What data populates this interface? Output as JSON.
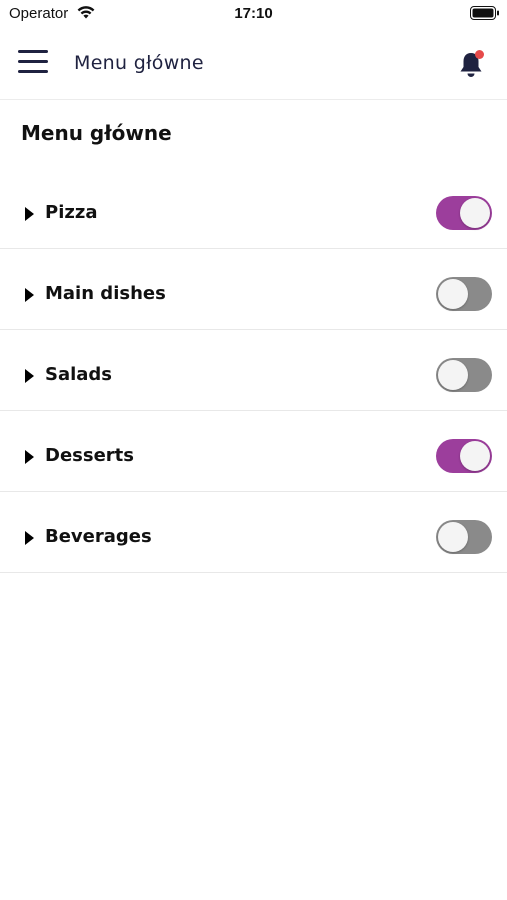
{
  "status_bar": {
    "carrier": "Operator",
    "time": "17:10",
    "wifi_icon": "wifi-icon",
    "battery_icon": "battery-icon"
  },
  "header": {
    "menu_icon": "hamburger-menu-icon",
    "title": "Menu główne",
    "bell_icon": "bell-icon",
    "has_notification": true,
    "notification_color": "#e64a4a"
  },
  "page": {
    "title": "Menu główne"
  },
  "colors": {
    "toggle_on": "#9c3e9c",
    "toggle_off": "#8a8a8a",
    "title_text": "#1f2240"
  },
  "categories": [
    {
      "label": "Pizza",
      "enabled": true
    },
    {
      "label": "Main dishes",
      "enabled": false
    },
    {
      "label": "Salads",
      "enabled": false
    },
    {
      "label": "Desserts",
      "enabled": true
    },
    {
      "label": "Beverages",
      "enabled": false
    }
  ]
}
